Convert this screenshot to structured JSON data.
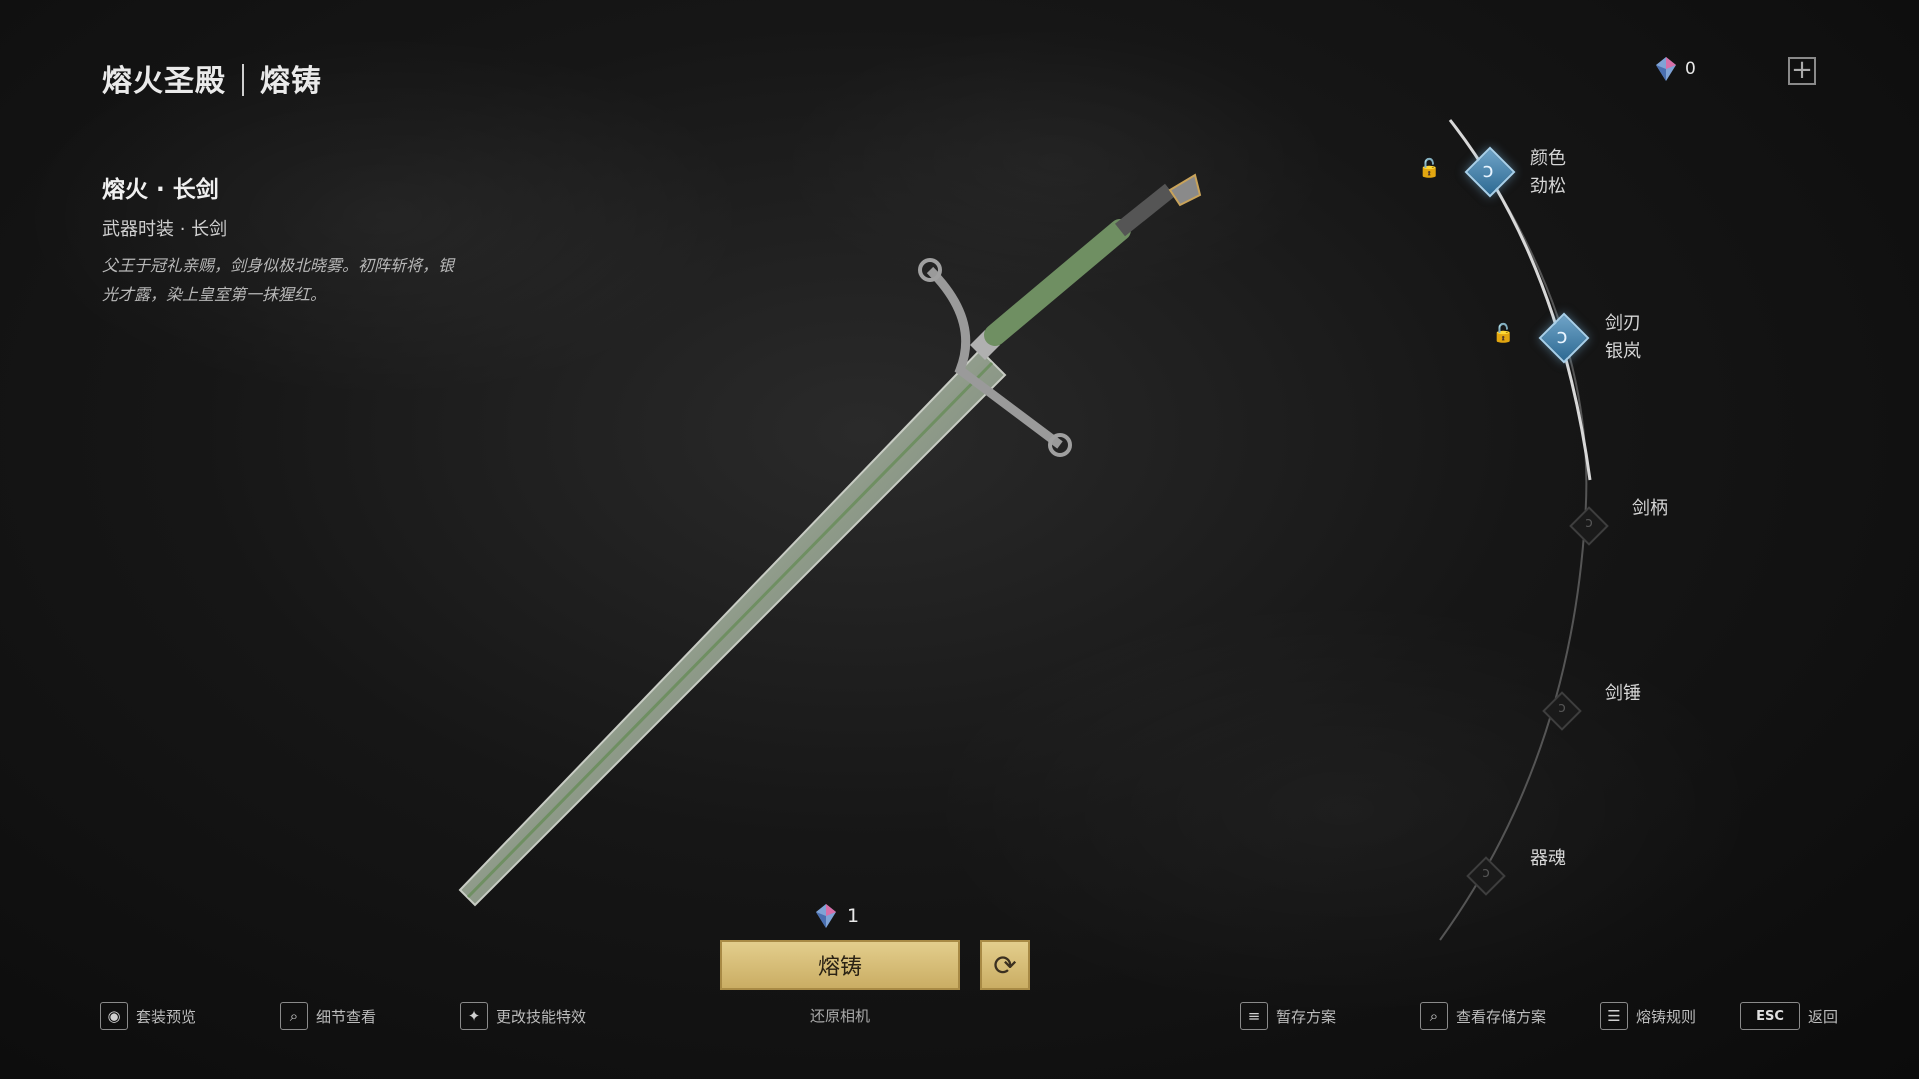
{
  "header": {
    "location": "熔火圣殿",
    "mode": "熔铸"
  },
  "item": {
    "title": "熔火 · 长剑",
    "type": "武器时装 · 长剑",
    "description": "父王于冠礼亲赐，剑身似极北晓雾。初阵斩将，银光才露，染上皇室第一抹猩红。"
  },
  "currency": {
    "icon": "gem-icon",
    "amount": "0"
  },
  "parts": [
    {
      "name": "颜色",
      "value": "劲松",
      "state": "active"
    },
    {
      "name": "剑刃",
      "value": "银岚",
      "state": "active"
    },
    {
      "name": "剑柄",
      "value": "",
      "state": "inactive"
    },
    {
      "name": "剑锤",
      "value": "",
      "state": "inactive"
    },
    {
      "name": "器魂",
      "value": "",
      "state": "inactive"
    }
  ],
  "forge": {
    "cost": "1",
    "button_label": "熔铸",
    "reset_camera": "还原相机"
  },
  "footer": {
    "outfit_preview": "套装预览",
    "detail_view": "细节查看",
    "change_skill_effect": "更改技能特效",
    "save_scheme": "暂存方案",
    "view_saved": "查看存储方案",
    "forge_rules": "熔铸规则",
    "esc_key": "ESC",
    "back": "返回"
  },
  "colors": {
    "accent_gold": "#d8c07a",
    "node_blue": "#4a8bb5",
    "blade_green": "#6f8f62"
  }
}
